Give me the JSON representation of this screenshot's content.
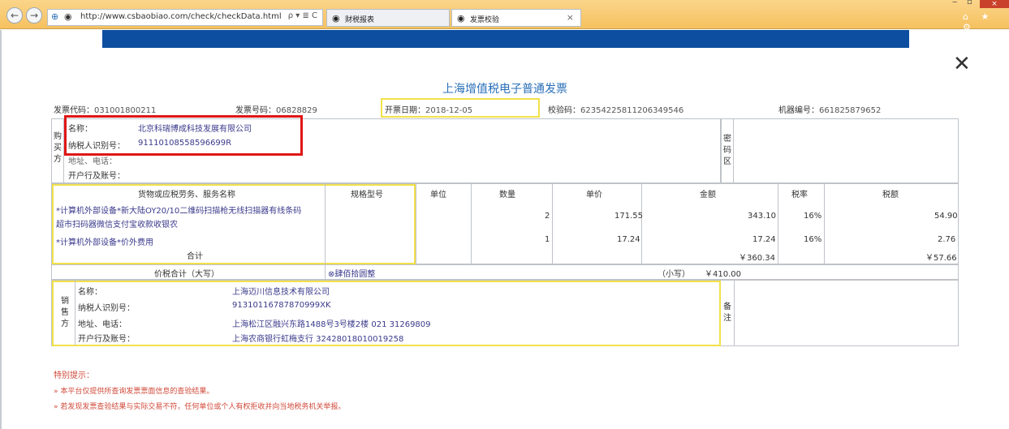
{
  "browser": {
    "back": "←",
    "forward": "→",
    "url": "http://www.csbaobiao.com/check/checkData.html",
    "addr_icons": "ρ ▾ ≣ C",
    "tabs": [
      {
        "label": "财税报表",
        "active": false
      },
      {
        "label": "发票校验",
        "active": true
      }
    ],
    "tab_close": "×",
    "window_close": "×",
    "window_min": "‒",
    "window_restore": "▫",
    "tool_icons": "⌂ ★ ⚙"
  },
  "page": {
    "close_symbol": "✕",
    "title": "上海增值税电子普通发票",
    "invoice_code_label": "发票代码：",
    "invoice_code": "031001800211",
    "invoice_no_label": "发票号码：",
    "invoice_no": "06828829",
    "issue_date_label": "开票日期：",
    "issue_date": "2018-12-05",
    "check_code_label": "校验码：",
    "check_code": "62354225811206349546",
    "machine_no_label": "机器编号：",
    "machine_no": "661825879652"
  },
  "buyer": {
    "side_label": "购买方",
    "name_label": "名称：",
    "name": "北京科瑞博成科技发展有限公司",
    "tax_id_label": "纳税人识别号：",
    "tax_id": "91110108558596699R",
    "address_label": "地址、电话：",
    "bank_label": "开户行及账号：",
    "cipher_label": "密码区"
  },
  "items": {
    "headers": [
      "货物或应税劳务、服务名称",
      "规格型号",
      "单位",
      "数量",
      "单价",
      "金额",
      "税率",
      "税额"
    ],
    "rows": [
      {
        "name1": "*计算机外部设备*新大陆OY20/10二维码扫描枪无线扫描器有线条码",
        "name2": "超市扫码器微信支付宝收款收银农",
        "qty": "2",
        "price": "171.55",
        "amount": "343.10",
        "rate": "16%",
        "tax": "54.90"
      },
      {
        "name1": "*计算机外部设备*价外费用",
        "name2": "",
        "qty": "1",
        "price": "17.24",
        "amount": "17.24",
        "rate": "16%",
        "tax": "2.76"
      }
    ],
    "total_label": "合计",
    "total_amount": "￥360.34",
    "total_tax": "￥57.66",
    "sum_label": "价税合计（大写）",
    "sum_words": "⊗肆佰拾圆整",
    "sum_small_label": "（小写）",
    "sum_small": "￥410.00"
  },
  "seller": {
    "side_label": "销售方",
    "name_label": "名称：",
    "name": "上海迈川信息技术有限公司",
    "tax_id_label": "纳税人识别号：",
    "tax_id": "91310116787870999XK",
    "address_label": "地址、电话：",
    "address": "上海松江区融兴东路1488号3号楼2楼 021 31269809",
    "bank_label": "开户行及账号：",
    "bank": "上海农商银行虹梅支行 32428018010019258",
    "remark_label": "备注"
  },
  "notice": {
    "title": "特别提示：",
    "lines": [
      "» 本平台仅提供所查询发票票面信息的查验结果。",
      "» 若发现发票查验结果与实际交易不符，任何单位或个人有权拒收并向当地税务机关举报。"
    ]
  },
  "colors": {
    "title_blue": "#2a6fb8",
    "banner_blue": "#0d4ea0",
    "highlight_red": "#e01616",
    "yellow_box": "#f2e14a",
    "notice_red": "#d04a3a"
  }
}
